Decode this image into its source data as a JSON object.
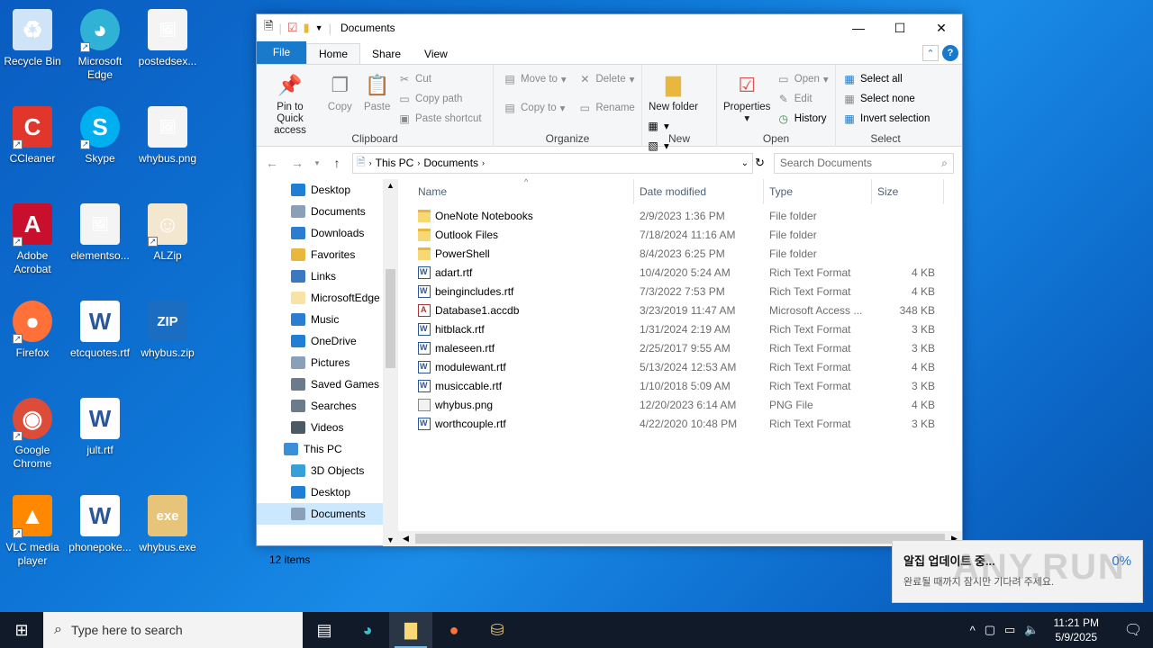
{
  "desktop_icons": [
    {
      "label": "Recycle Bin",
      "icon": "recycle-bin-icon"
    },
    {
      "label": "Microsoft Edge",
      "icon": "edge-icon"
    },
    {
      "label": "postedsex...",
      "icon": "image-file-icon"
    },
    {
      "label": "CCleaner",
      "icon": "ccleaner-icon"
    },
    {
      "label": "Skype",
      "icon": "skype-icon"
    },
    {
      "label": "whybus.png",
      "icon": "image-file-icon"
    },
    {
      "label": "Adobe Acrobat",
      "icon": "acrobat-icon"
    },
    {
      "label": "elementso...",
      "icon": "image-file-icon"
    },
    {
      "label": "ALZip",
      "icon": "alzip-icon"
    },
    {
      "label": "Firefox",
      "icon": "firefox-icon"
    },
    {
      "label": "etcquotes.rtf",
      "icon": "word-doc-icon"
    },
    {
      "label": "whybus.zip",
      "icon": "zip-file-icon"
    },
    {
      "label": "Google Chrome",
      "icon": "chrome-icon"
    },
    {
      "label": "jult.rtf",
      "icon": "word-doc-icon"
    },
    {
      "label": "VLC media player",
      "icon": "vlc-icon"
    },
    {
      "label": "phonepoke...",
      "icon": "word-doc-icon"
    },
    {
      "label": "whybus.exe",
      "icon": "exe-file-icon"
    }
  ],
  "window": {
    "title": "Documents",
    "tabs": {
      "file": "File",
      "home": "Home",
      "share": "Share",
      "view": "View"
    },
    "ribbon": {
      "clipboard": {
        "label": "Clipboard",
        "pin": "Pin to Quick access",
        "copy": "Copy",
        "paste": "Paste",
        "cut": "Cut",
        "copy_path": "Copy path",
        "paste_shortcut": "Paste shortcut"
      },
      "organize": {
        "label": "Organize",
        "move_to": "Move to",
        "copy_to": "Copy to",
        "delete": "Delete",
        "rename": "Rename"
      },
      "new": {
        "label": "New",
        "new_folder": "New folder"
      },
      "open": {
        "label": "Open",
        "properties": "Properties",
        "open": "Open",
        "edit": "Edit",
        "history": "History"
      },
      "select": {
        "label": "Select",
        "select_all": "Select all",
        "select_none": "Select none",
        "invert": "Invert selection"
      }
    },
    "address": {
      "crumbs": [
        "This PC",
        "Documents"
      ],
      "search_placeholder": "Search Documents"
    },
    "nav_items": [
      {
        "label": "Desktop",
        "color": "#1f7fd6",
        "indent": 38
      },
      {
        "label": "Documents",
        "color": "#8aa0b8",
        "indent": 38
      },
      {
        "label": "Downloads",
        "color": "#2a7dd1",
        "indent": 38
      },
      {
        "label": "Favorites",
        "color": "#e8b83e",
        "indent": 38
      },
      {
        "label": "Links",
        "color": "#3a79c2",
        "indent": 38
      },
      {
        "label": "MicrosoftEdge",
        "color": "#f8e3a6",
        "indent": 38
      },
      {
        "label": "Music",
        "color": "#2a7dd1",
        "indent": 38
      },
      {
        "label": "OneDrive",
        "color": "#1f7fd6",
        "indent": 38
      },
      {
        "label": "Pictures",
        "color": "#8aa0b8",
        "indent": 38
      },
      {
        "label": "Saved Games",
        "color": "#6b7b8c",
        "indent": 38
      },
      {
        "label": "Searches",
        "color": "#6b7b8c",
        "indent": 38
      },
      {
        "label": "Videos",
        "color": "#4d5a66",
        "indent": 38
      },
      {
        "label": "This PC",
        "color": "#3b8fd9",
        "indent": 30
      },
      {
        "label": "3D Objects",
        "color": "#38a0d8",
        "indent": 38
      },
      {
        "label": "Desktop",
        "color": "#1f7fd6",
        "indent": 38
      },
      {
        "label": "Documents",
        "color": "#8aa0b8",
        "indent": 38,
        "selected": true
      }
    ],
    "columns": {
      "name": "Name",
      "date": "Date modified",
      "type": "Type",
      "size": "Size"
    },
    "files": [
      {
        "name": "OneNote Notebooks",
        "date": "2/9/2023 1:36 PM",
        "type": "File folder",
        "size": "",
        "kind": "fold"
      },
      {
        "name": "Outlook Files",
        "date": "7/18/2024 11:16 AM",
        "type": "File folder",
        "size": "",
        "kind": "fold"
      },
      {
        "name": "PowerShell",
        "date": "8/4/2023 6:25 PM",
        "type": "File folder",
        "size": "",
        "kind": "fold"
      },
      {
        "name": "adart.rtf",
        "date": "10/4/2020 5:24 AM",
        "type": "Rich Text Format",
        "size": "4 KB",
        "kind": "rtf"
      },
      {
        "name": "beingincludes.rtf",
        "date": "7/3/2022 7:53 PM",
        "type": "Rich Text Format",
        "size": "4 KB",
        "kind": "rtf"
      },
      {
        "name": "Database1.accdb",
        "date": "3/23/2019 11:47 AM",
        "type": "Microsoft Access ...",
        "size": "348 KB",
        "kind": "acc"
      },
      {
        "name": "hitblack.rtf",
        "date": "1/31/2024 2:19 AM",
        "type": "Rich Text Format",
        "size": "3 KB",
        "kind": "rtf"
      },
      {
        "name": "maleseen.rtf",
        "date": "2/25/2017 9:55 AM",
        "type": "Rich Text Format",
        "size": "3 KB",
        "kind": "rtf"
      },
      {
        "name": "modulewant.rtf",
        "date": "5/13/2024 12:53 AM",
        "type": "Rich Text Format",
        "size": "4 KB",
        "kind": "rtf"
      },
      {
        "name": "musiccable.rtf",
        "date": "1/10/2018 5:09 AM",
        "type": "Rich Text Format",
        "size": "3 KB",
        "kind": "rtf"
      },
      {
        "name": "whybus.png",
        "date": "12/20/2023 6:14 AM",
        "type": "PNG File",
        "size": "4 KB",
        "kind": "png"
      },
      {
        "name": "worthcouple.rtf",
        "date": "4/22/2020 10:48 PM",
        "type": "Rich Text Format",
        "size": "3 KB",
        "kind": "rtf"
      }
    ],
    "status": "12 items"
  },
  "toast": {
    "title": "알집 업데이트 중...",
    "body": "완료될 때까지 잠시만 기다려 주세요.",
    "percent": "0%"
  },
  "watermark": "ANY.RUN",
  "taskbar": {
    "search_placeholder": "Type here to search",
    "time": "11:21 PM",
    "date": "5/9/2025"
  }
}
